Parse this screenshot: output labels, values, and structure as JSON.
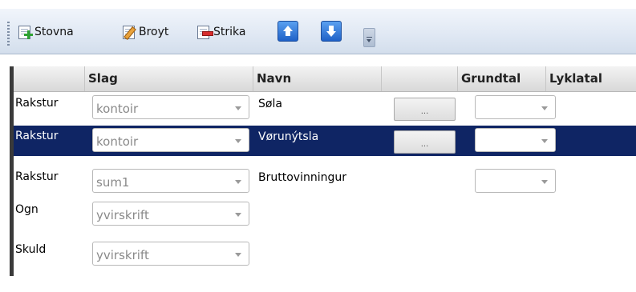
{
  "toolbar": {
    "stovna_label": "Stovna",
    "broyt_label": "Broyt",
    "strika_label": "Strika"
  },
  "grid": {
    "columns": [
      "",
      "Slag",
      "Navn",
      "",
      "Grundtal",
      "Lyklatal"
    ],
    "rows": [
      {
        "type": "Rakstur",
        "slag": "kontoir",
        "navn": "Søla",
        "dots": "...",
        "selected": false
      },
      {
        "type": "Rakstur",
        "slag": "kontoir",
        "navn": "Vørunýtsla",
        "dots": "...",
        "selected": true
      },
      {
        "type": "Rakstur",
        "slag": "sum1",
        "navn": "Bruttovinningur",
        "dots": "",
        "selected": false
      },
      {
        "type": "Ogn",
        "slag": "yvirskrift",
        "navn": "",
        "dots": "",
        "selected": false
      },
      {
        "type": "Skuld",
        "slag": "yvirskrift",
        "navn": "",
        "dots": "",
        "selected": false
      }
    ]
  },
  "colors": {
    "selected_row_bg": "#0f2564",
    "toolbar_top": "#f1f5fb",
    "toolbar_bottom": "#d3deec"
  }
}
